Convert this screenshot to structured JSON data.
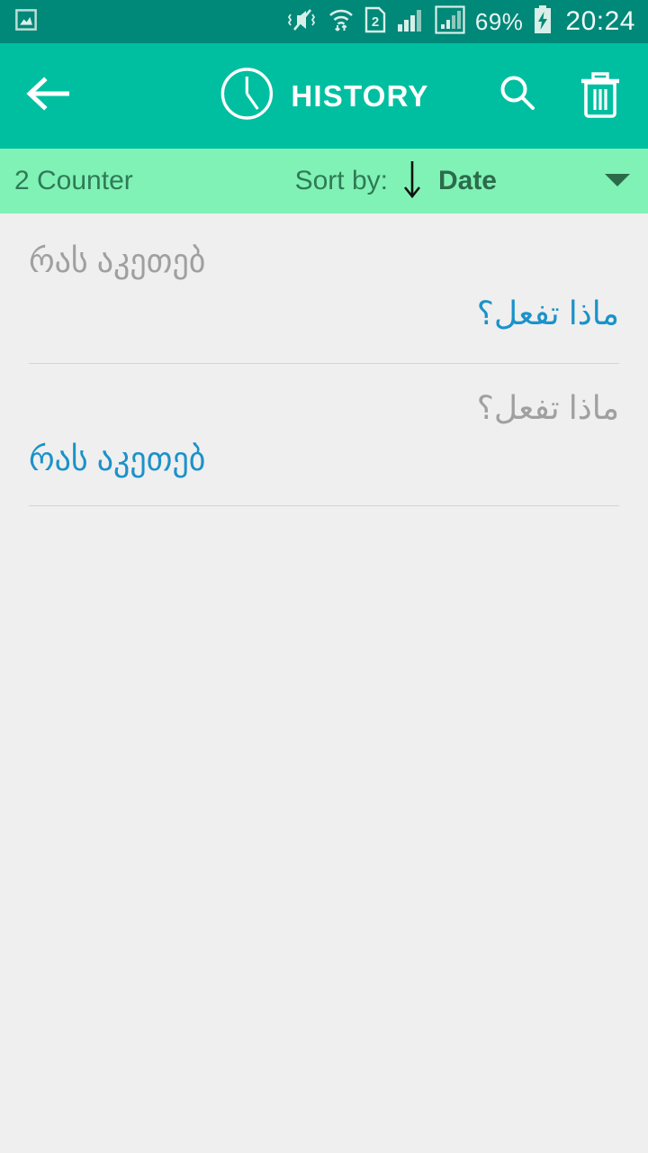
{
  "status_bar": {
    "notification_icon": "image-icon",
    "icons": [
      "mute-vibrate-icon",
      "wifi-icon",
      "sim2-icon",
      "signal-bars-icon",
      "signal-bars-boxed-icon"
    ],
    "battery_percent": "69%",
    "battery_icon": "battery-charging-icon",
    "time": "20:24",
    "background_color": "#008878"
  },
  "app_bar": {
    "back_icon": "arrow-left-icon",
    "title_icon": "clock-icon",
    "title": "HISTORY",
    "search_icon": "search-icon",
    "delete_icon": "trash-icon",
    "background_color": "#00bfa1"
  },
  "sort_bar": {
    "counter_label": "2 Counter",
    "sort_by_label": "Sort by:",
    "sort_direction_icon": "arrow-down-icon",
    "sort_value": "Date",
    "caret_icon": "chevron-down-icon",
    "background_color": "#80f2b5"
  },
  "history": {
    "items": [
      {
        "source_text": "რას აკეთებ",
        "source_align": "left",
        "target_text": "ماذا تفعل؟",
        "target_align": "right"
      },
      {
        "source_text": "ماذا تفعل؟",
        "source_align": "right",
        "target_text": "რას აკეთებ",
        "target_align": "left"
      }
    ],
    "source_color": "#a0a0a0",
    "target_color": "#1c92c9",
    "background_color": "#efefef"
  }
}
